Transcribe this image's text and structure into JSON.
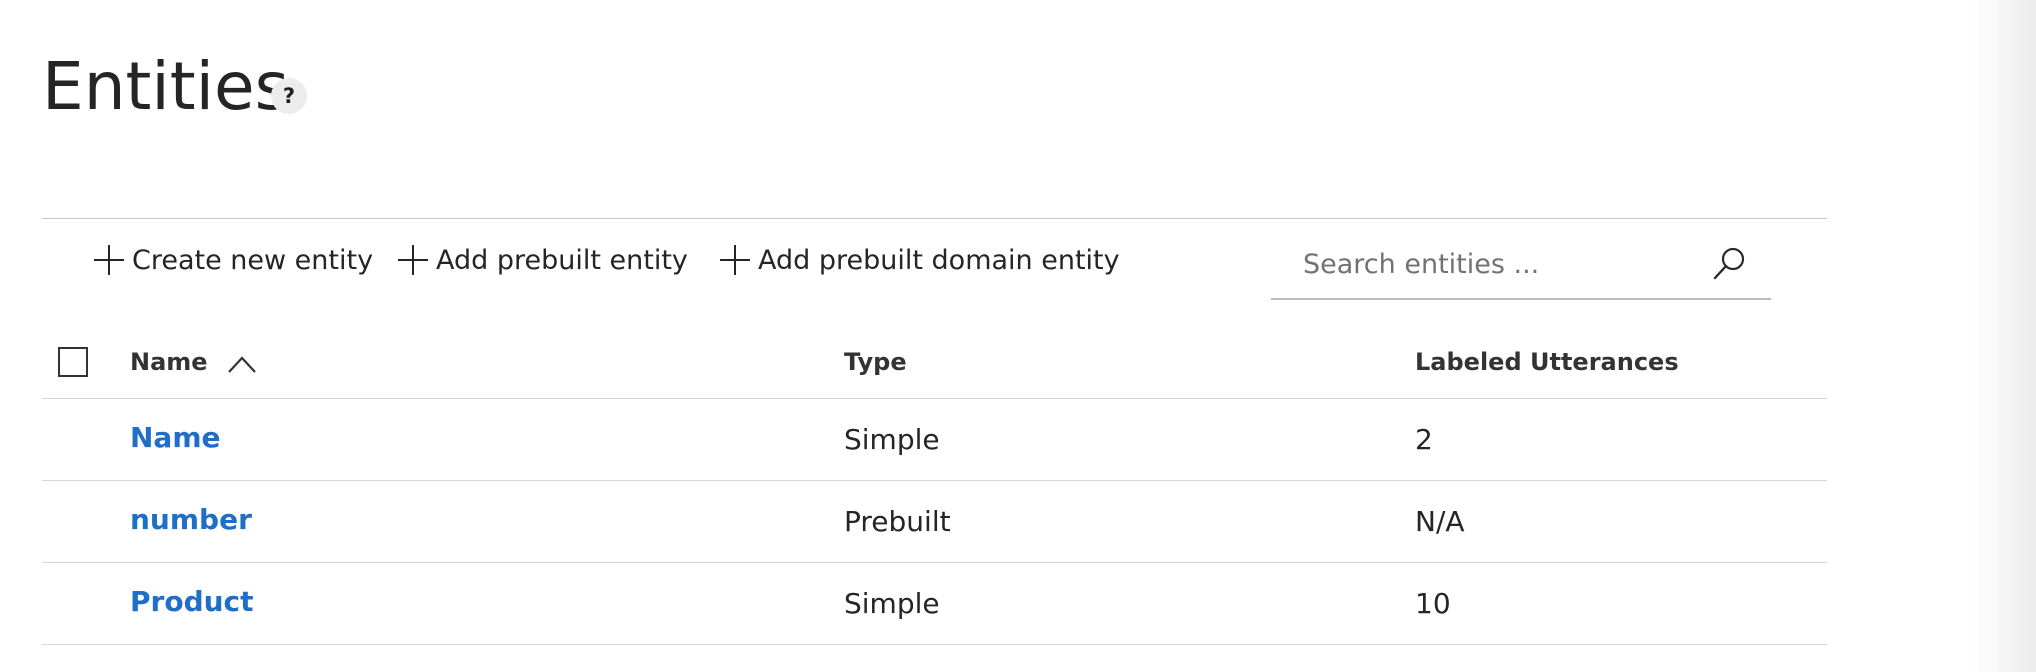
{
  "page": {
    "title": "Entities",
    "help_label": "?"
  },
  "toolbar": {
    "create_label": "Create new entity",
    "add_prebuilt_label": "Add prebuilt entity",
    "add_domain_label": "Add prebuilt domain entity",
    "search_placeholder": "Search entities ...",
    "search_value": ""
  },
  "table": {
    "columns": {
      "name": "Name",
      "type": "Type",
      "labeled": "Labeled Utterances"
    },
    "sort": {
      "column": "Name",
      "direction": "ascending"
    },
    "rows": [
      {
        "name": "Name",
        "type": "Simple",
        "labeled": "2"
      },
      {
        "name": "number",
        "type": "Prebuilt",
        "labeled": "N/A"
      },
      {
        "name": "Product",
        "type": "Simple",
        "labeled": "10"
      }
    ]
  },
  "colors": {
    "link": "#1f6ec7",
    "text": "#252525",
    "divider": "#d6d6d6"
  },
  "icons": [
    "help-icon",
    "plus-icon",
    "search-icon",
    "chevron-up-icon",
    "checkbox-icon"
  ]
}
